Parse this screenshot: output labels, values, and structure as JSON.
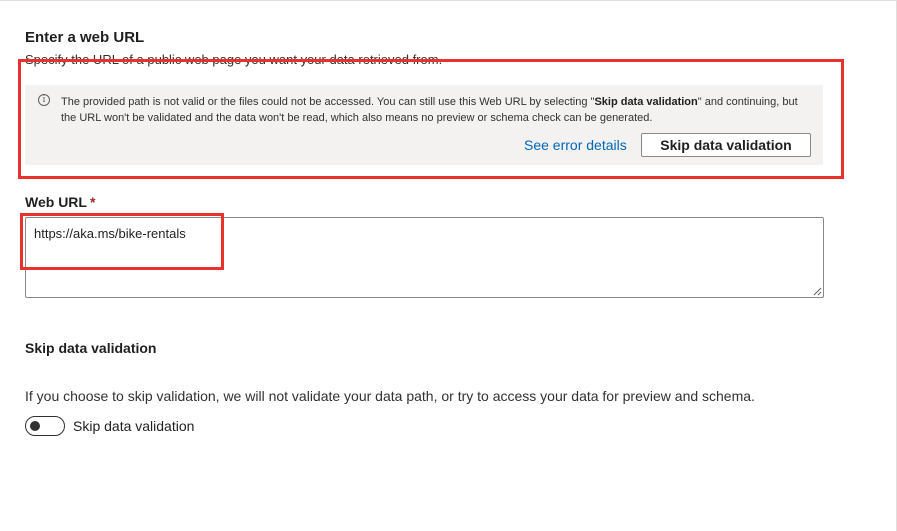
{
  "section": {
    "title": "Enter a web URL",
    "description": "Specify the URL of a public web page you want your data retrieved from."
  },
  "warning": {
    "icon": "info-icon",
    "text_before": "The provided path is not valid or the files could not be accessed. You can still use this Web URL by selecting \"",
    "text_bold": "Skip data validation",
    "text_after": "\" and continuing, but the URL won't be validated and the data won't be read, which also means no preview or schema check can be generated.",
    "link_label": "See error details",
    "button_label": "Skip data validation"
  },
  "web_url": {
    "label": "Web URL",
    "required_marker": "*",
    "value": "https://aka.ms/bike-rentals"
  },
  "skip_validation": {
    "heading": "Skip data validation",
    "description": "If you choose to skip validation, we will not validate your data path, or try to access your data for preview and schema.",
    "toggle_label": "Skip data validation",
    "toggle_on": false
  },
  "colors": {
    "highlight": "#e8322d",
    "link": "#0067b8",
    "required": "#a4262c",
    "warning_bg": "#f3f2f1"
  }
}
